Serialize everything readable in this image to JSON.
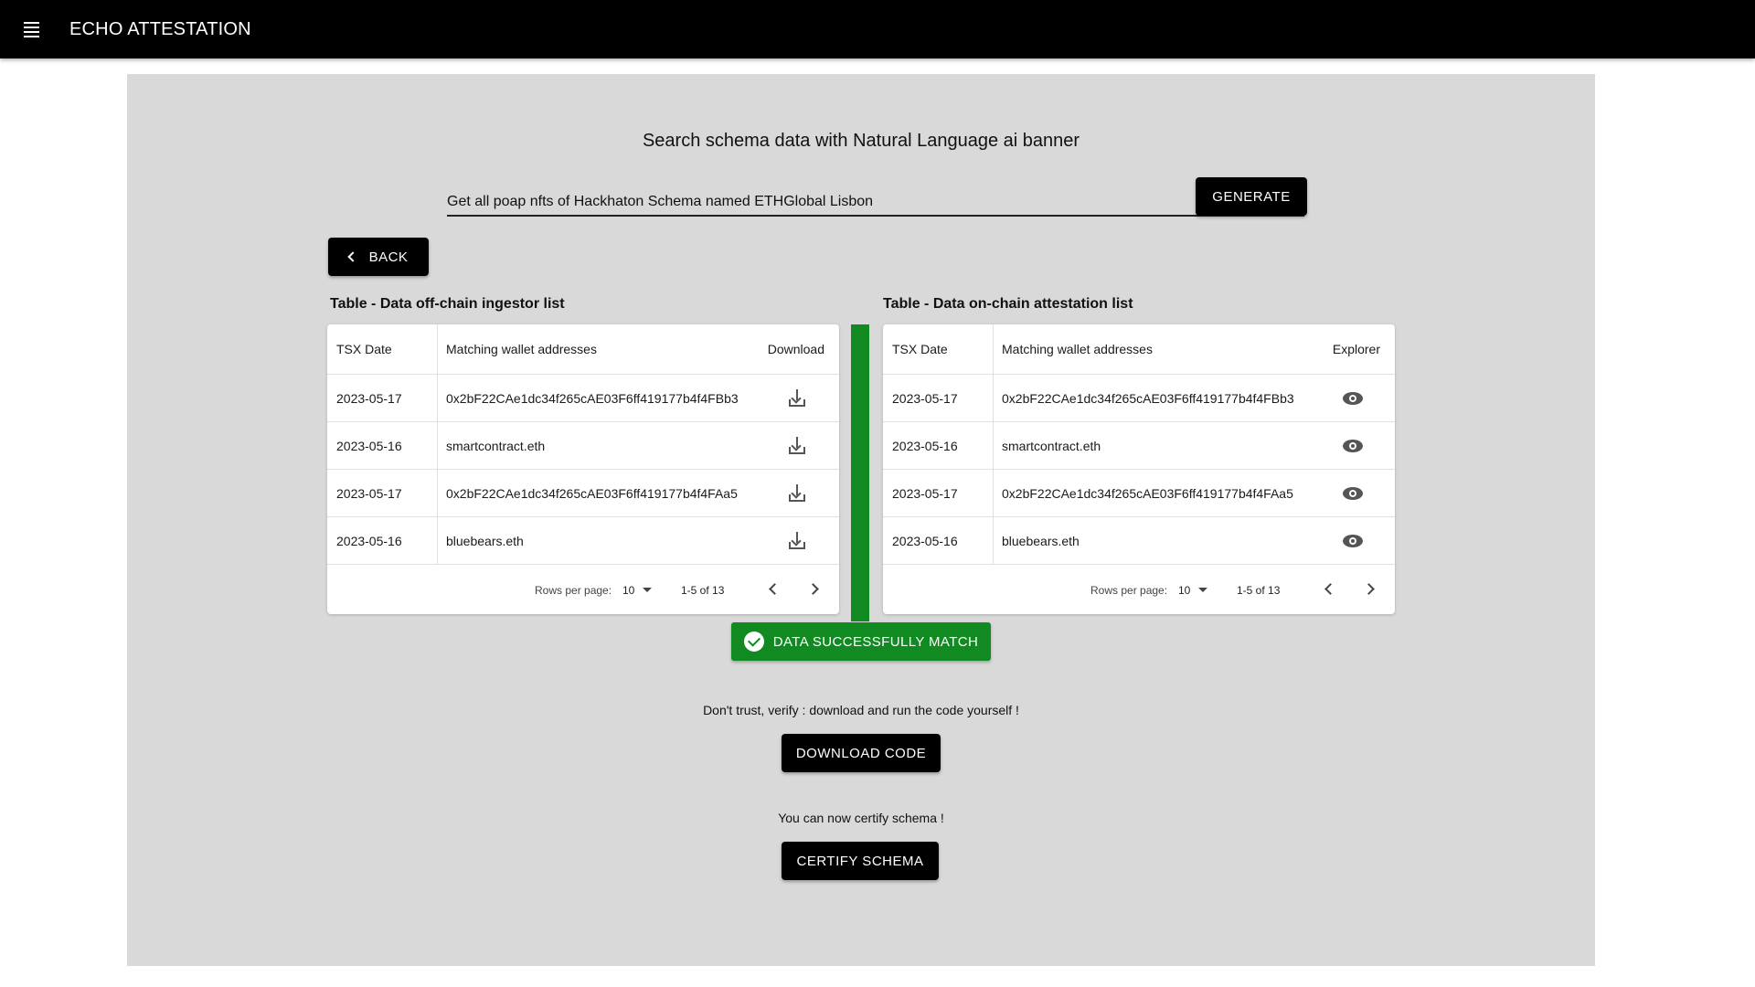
{
  "app": {
    "title": "ECHO ATTESTATION",
    "menu_icon": "menu-icon"
  },
  "search": {
    "headline": "Search schema data with Natural Language ai banner",
    "value": "Get all poap nfts of Hackhaton Schema named ETHGlobal Lisbon",
    "placeholder": "",
    "generate_label": "GENERATE"
  },
  "back_label": "BACK",
  "left_table": {
    "title": "Table - Data off-chain ingestor list",
    "headers": [
      "TSX Date",
      "Matching wallet addresses",
      "Download"
    ],
    "rows": [
      {
        "date": "2023-05-17",
        "address": "0x2bF22CAe1dc34f265cAE03F6ff419177b4f4FBb3",
        "icon": "download-icon"
      },
      {
        "date": "2023-05-16",
        "address": "smartcontract.eth",
        "icon": "download-icon"
      },
      {
        "date": "2023-05-17",
        "address": "0x2bF22CAe1dc34f265cAE03F6ff419177b4f4FAa5",
        "icon": "download-icon"
      },
      {
        "date": "2023-05-16",
        "address": "bluebears.eth",
        "icon": "download-icon"
      }
    ],
    "rows_per_page_label": "Rows per page:",
    "rows_per_page_value": "10",
    "range": "1-5 of 13"
  },
  "right_table": {
    "title": "Table - Data on-chain attestation list",
    "headers": [
      "TSX Date",
      "Matching wallet addresses",
      "Explorer"
    ],
    "rows": [
      {
        "date": "2023-05-17",
        "address": "0x2bF22CAe1dc34f265cAE03F6ff419177b4f4FBb3",
        "icon": "eye-icon"
      },
      {
        "date": "2023-05-16",
        "address": "smartcontract.eth",
        "icon": "eye-icon"
      },
      {
        "date": "2023-05-17",
        "address": "0x2bF22CAe1dc34f265cAE03F6ff419177b4f4FAa5",
        "icon": "eye-icon"
      },
      {
        "date": "2023-05-16",
        "address": "bluebears.eth",
        "icon": "eye-icon"
      }
    ],
    "rows_per_page_label": "Rows per page:",
    "rows_per_page_value": "10",
    "range": "1-5 of 13"
  },
  "match_badge": "DATA SUCCESSFULLY MATCH",
  "verify_note": "Don't trust, verify : download and run the code yourself !",
  "download_code_label": "DOWNLOAD CODE",
  "certify_note": "You can now certify schema !",
  "certify_label": "CERTIFY SCHEMA",
  "colors": {
    "appbar": "#000000",
    "panel": "#d9d9d9",
    "success": "#128a22"
  }
}
